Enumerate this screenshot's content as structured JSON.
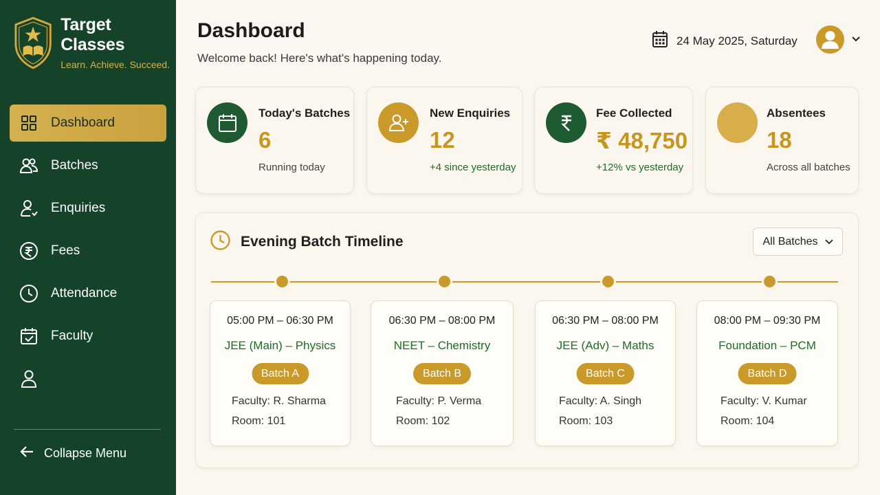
{
  "brand": {
    "name": "Target Classes",
    "tagline": "Learn. Achieve. Succeed."
  },
  "sidebar": {
    "items": [
      {
        "label": "Dashboard",
        "icon": "grid-icon",
        "active": true
      },
      {
        "label": "Batches",
        "icon": "users-icon"
      },
      {
        "label": "Enquiries",
        "icon": "user-question-icon"
      },
      {
        "label": "Fees",
        "icon": "rupee-icon"
      },
      {
        "label": "Attendance",
        "icon": "clock-icon"
      },
      {
        "label": "Faculty",
        "icon": "calendar-check-icon"
      },
      {
        "label": "",
        "icon": "user-icon"
      }
    ],
    "collapse_label": "Collapse Menu"
  },
  "header": {
    "title": "Dashboard",
    "subtitle": "Welcome back! Here's what's happening today.",
    "date": "24 May 2025, Saturday"
  },
  "stats": [
    {
      "label": "Today's Batches",
      "value": "6",
      "note": "Running today",
      "icon": "calendar-icon",
      "color": "#1e5a32"
    },
    {
      "label": "New Enquiries",
      "value": "12",
      "note": "+4 since yesterday",
      "icon": "user-plus-icon",
      "color": "#c99a2a"
    },
    {
      "label": "Fee Collected",
      "value": "₹ 48,750",
      "note": "+12% vs yesterday",
      "icon": "rupee-icon",
      "color": "#1e5a32"
    },
    {
      "label": "Absentees",
      "value": "18",
      "note": "Across all batches",
      "icon": "blank-circle-icon",
      "color": "#d8ae4a"
    }
  ],
  "timeline": {
    "title": "Evening Batch Timeline",
    "filter": "All Batches",
    "batches": [
      {
        "time": "05:00 PM – 06:30 PM",
        "course": "JEE (Main) – Physics",
        "badge": "Batch A",
        "faculty": "Faculty: R. Sharma",
        "room": "Room: 101"
      },
      {
        "time": "06:30 PM – 08:00 PM",
        "course": "NEET – Chemistry",
        "badge": "Batch B",
        "faculty": "Faculty: P. Verma",
        "room": "Room: 102"
      },
      {
        "time": "06:30 PM – 08:00 PM",
        "course": "JEE (Adv) – Maths",
        "badge": "Batch C",
        "faculty": "Faculty: A. Singh",
        "room": "Room: 103"
      },
      {
        "time": "08:00 PM – 09:30 PM",
        "course": "Foundation – PCM",
        "badge": "Batch D",
        "faculty": "Faculty: V. Kumar",
        "room": "Room: 104"
      }
    ]
  },
  "colors": {
    "sidebar": "#14432a",
    "accent": "#c99a2a",
    "green_text": "#1e6b2b"
  }
}
